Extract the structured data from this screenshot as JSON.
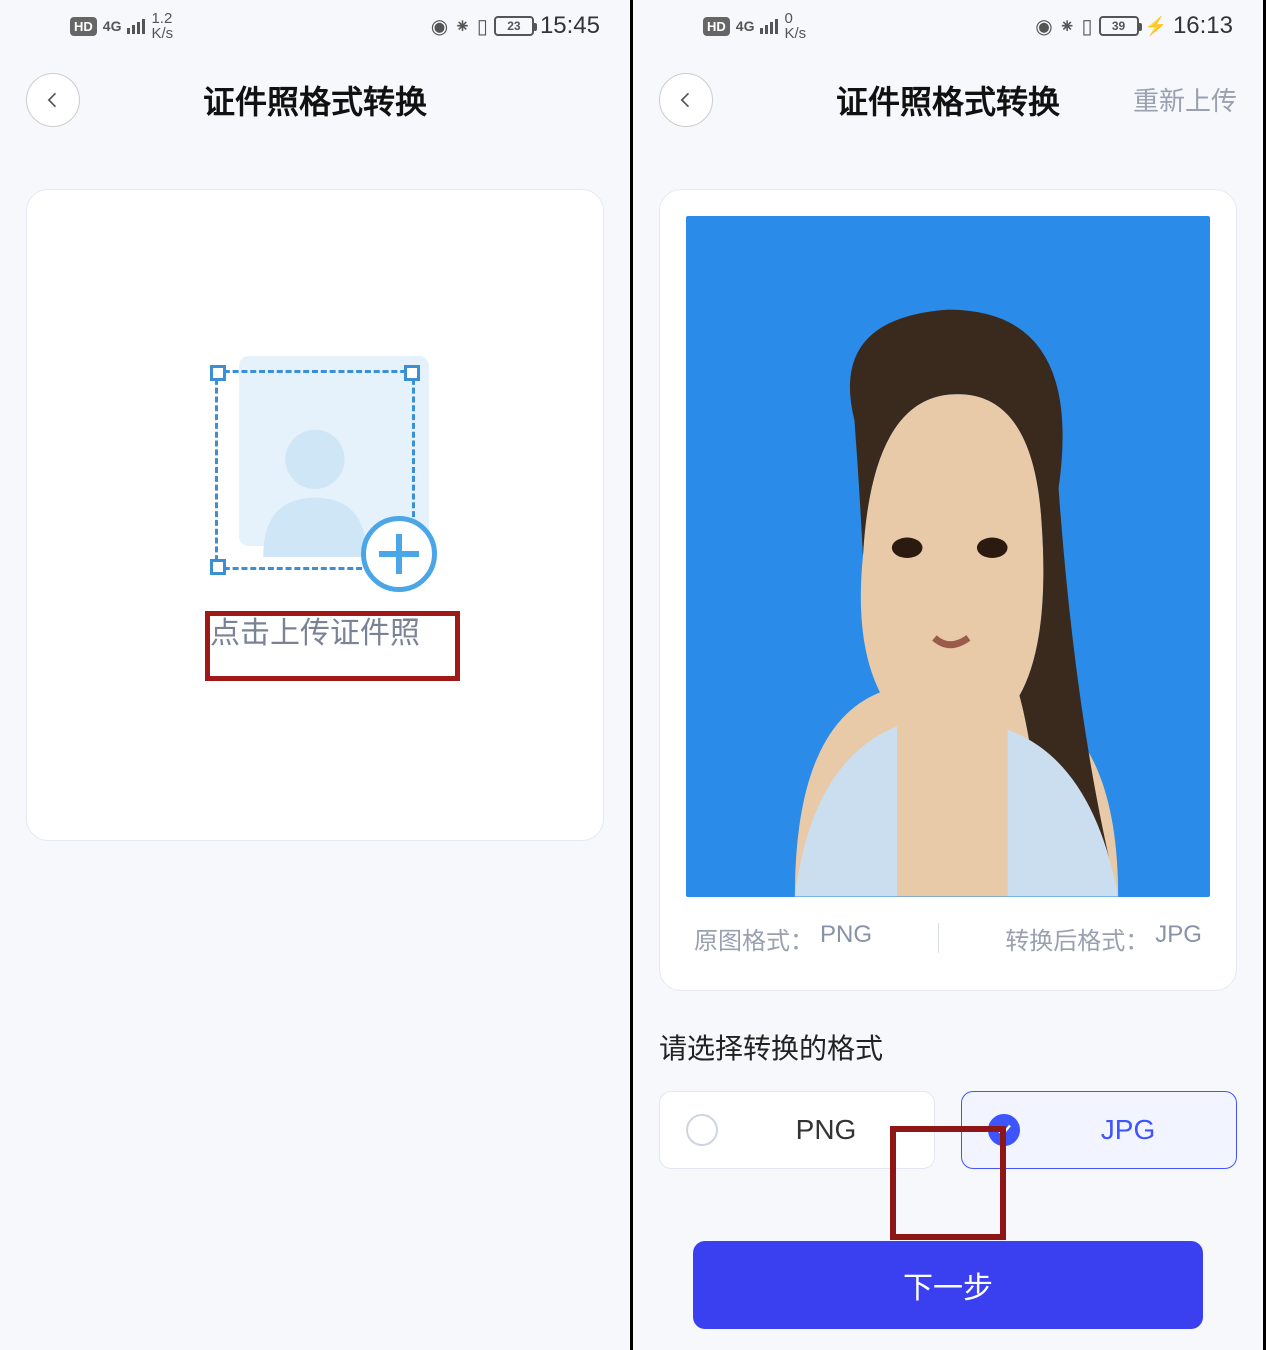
{
  "left": {
    "status": {
      "hd": "HD",
      "net": "4G",
      "speed_top": "1.2",
      "speed_bot": "K/s",
      "battery": "23",
      "time": "15:45"
    },
    "nav": {
      "title": "证件照格式转换"
    },
    "upload": {
      "label": "点击上传证件照"
    }
  },
  "right": {
    "status": {
      "hd": "HD",
      "net": "4G",
      "speed_top": "0",
      "speed_bot": "K/s",
      "battery": "39",
      "time": "16:13"
    },
    "nav": {
      "title": "证件照格式转换",
      "reupload": "重新上传"
    },
    "preview": {
      "orig_label": "原图格式：",
      "orig_val": "PNG",
      "conv_label": "转换后格式：",
      "conv_val": "JPG"
    },
    "choose_label": "请选择转换的格式",
    "options": {
      "png": "PNG",
      "jpg": "JPG"
    },
    "next": "下一步"
  }
}
